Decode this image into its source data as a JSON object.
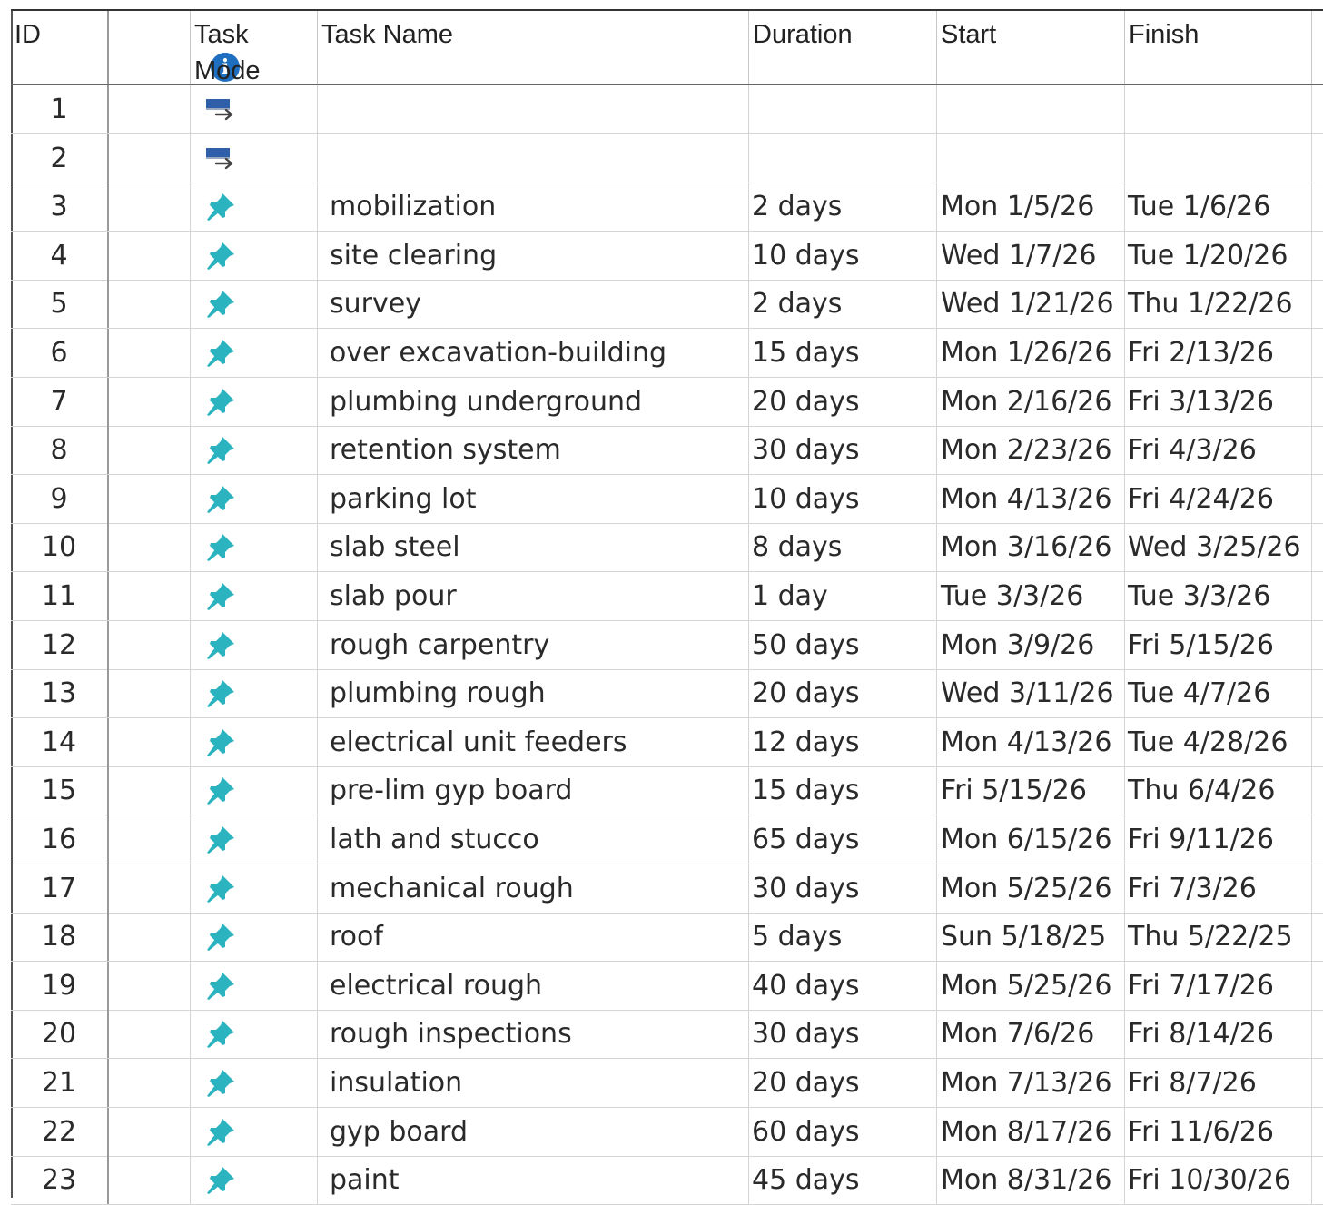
{
  "table": {
    "headers": {
      "id": "ID",
      "task_mode_line1": "Task",
      "task_mode_line2": "Mode",
      "task_name": "Task Name",
      "duration": "Duration",
      "start": "Start",
      "finish": "Finish"
    },
    "indicator_icon": "info-icon",
    "rows": [
      {
        "id": "1",
        "mode": "auto-scheduled-icon",
        "name": "",
        "duration": "",
        "start": "",
        "finish": ""
      },
      {
        "id": "2",
        "mode": "auto-scheduled-icon",
        "name": "",
        "duration": "",
        "start": "",
        "finish": ""
      },
      {
        "id": "3",
        "mode": "manual-pin-icon",
        "name": "mobilization",
        "duration": "2 days",
        "start": "Mon 1/5/26",
        "finish": "Tue 1/6/26"
      },
      {
        "id": "4",
        "mode": "manual-pin-icon",
        "name": "site clearing",
        "duration": "10 days",
        "start": "Wed 1/7/26",
        "finish": "Tue 1/20/26"
      },
      {
        "id": "5",
        "mode": "manual-pin-icon",
        "name": "survey",
        "duration": "2 days",
        "start": "Wed 1/21/26",
        "finish": "Thu 1/22/26"
      },
      {
        "id": "6",
        "mode": "manual-pin-icon",
        "name": "over excavation-building",
        "duration": "15 days",
        "start": "Mon 1/26/26",
        "finish": "Fri 2/13/26"
      },
      {
        "id": "7",
        "mode": "manual-pin-icon",
        "name": "plumbing underground",
        "duration": "20 days",
        "start": "Mon 2/16/26",
        "finish": "Fri 3/13/26"
      },
      {
        "id": "8",
        "mode": "manual-pin-icon",
        "name": "retention system",
        "duration": "30 days",
        "start": "Mon 2/23/26",
        "finish": "Fri 4/3/26"
      },
      {
        "id": "9",
        "mode": "manual-pin-icon",
        "name": "parking lot",
        "duration": "10 days",
        "start": "Mon 4/13/26",
        "finish": "Fri 4/24/26"
      },
      {
        "id": "10",
        "mode": "manual-pin-icon",
        "name": "slab steel",
        "duration": "8 days",
        "start": "Mon 3/16/26",
        "finish": "Wed 3/25/26"
      },
      {
        "id": "11",
        "mode": "manual-pin-icon",
        "name": "slab pour",
        "duration": "1 day",
        "start": "Tue 3/3/26",
        "finish": "Tue 3/3/26"
      },
      {
        "id": "12",
        "mode": "manual-pin-icon",
        "name": "rough carpentry",
        "duration": "50 days",
        "start": "Mon 3/9/26",
        "finish": "Fri 5/15/26"
      },
      {
        "id": "13",
        "mode": "manual-pin-icon",
        "name": "plumbing rough",
        "duration": "20 days",
        "start": "Wed 3/11/26",
        "finish": "Tue 4/7/26"
      },
      {
        "id": "14",
        "mode": "manual-pin-icon",
        "name": "electrical unit feeders",
        "duration": "12 days",
        "start": "Mon 4/13/26",
        "finish": "Tue 4/28/26"
      },
      {
        "id": "15",
        "mode": "manual-pin-icon",
        "name": "pre-lim gyp board",
        "duration": "15 days",
        "start": "Fri 5/15/26",
        "finish": "Thu 6/4/26"
      },
      {
        "id": "16",
        "mode": "manual-pin-icon",
        "name": "lath and stucco",
        "duration": "65 days",
        "start": "Mon 6/15/26",
        "finish": "Fri 9/11/26"
      },
      {
        "id": "17",
        "mode": "manual-pin-icon",
        "name": "mechanical rough",
        "duration": "30 days",
        "start": "Mon 5/25/26",
        "finish": "Fri 7/3/26"
      },
      {
        "id": "18",
        "mode": "manual-pin-icon",
        "name": "roof",
        "duration": "5 days",
        "start": "Sun 5/18/25",
        "finish": "Thu 5/22/25"
      },
      {
        "id": "19",
        "mode": "manual-pin-icon",
        "name": "electrical rough",
        "duration": "40 days",
        "start": "Mon 5/25/26",
        "finish": "Fri 7/17/26"
      },
      {
        "id": "20",
        "mode": "manual-pin-icon",
        "name": "rough inspections",
        "duration": "30 days",
        "start": "Mon 7/6/26",
        "finish": "Fri 8/14/26"
      },
      {
        "id": "21",
        "mode": "manual-pin-icon",
        "name": "insulation",
        "duration": "20 days",
        "start": "Mon 7/13/26",
        "finish": "Fri 8/7/26"
      },
      {
        "id": "22",
        "mode": "manual-pin-icon",
        "name": "gyp board",
        "duration": "60 days",
        "start": "Mon 8/17/26",
        "finish": "Fri 11/6/26"
      },
      {
        "id": "23",
        "mode": "manual-pin-icon",
        "name": "paint",
        "duration": "45 days",
        "start": "Mon 8/31/26",
        "finish": "Fri 10/30/26"
      }
    ]
  },
  "colors": {
    "auto_icon_bar": "#2f5fa8",
    "pin_icon": "#2bb3bf",
    "info_icon": "#1f6fc1"
  }
}
